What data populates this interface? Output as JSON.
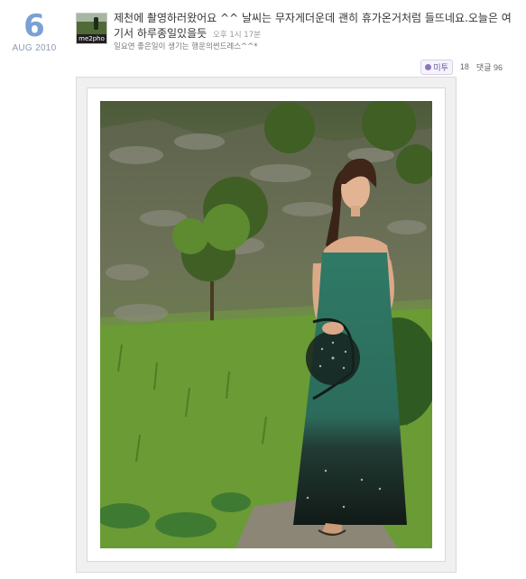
{
  "date": {
    "day": "6",
    "month_year": "AUG 2010"
  },
  "avatar": {
    "label": "me2pho"
  },
  "post": {
    "text": "제천에 촬영하러왔어요 ^^ 날씨는 무자게더운데 괜히 휴가온거처럼 들뜨네요.오늘은 여기서 하루종일있을듯",
    "time": "오후 1시 17분",
    "sub": "일요연 좋은일이 생기는 행운의썬드레스^^*"
  },
  "meta": {
    "me2_label": "미투",
    "me2_count": "18",
    "comments_label": "댓글 96"
  },
  "colors": {
    "accent": "#7aa0d4",
    "me2": "#8a76c0",
    "dress": "#2f6b5c"
  }
}
